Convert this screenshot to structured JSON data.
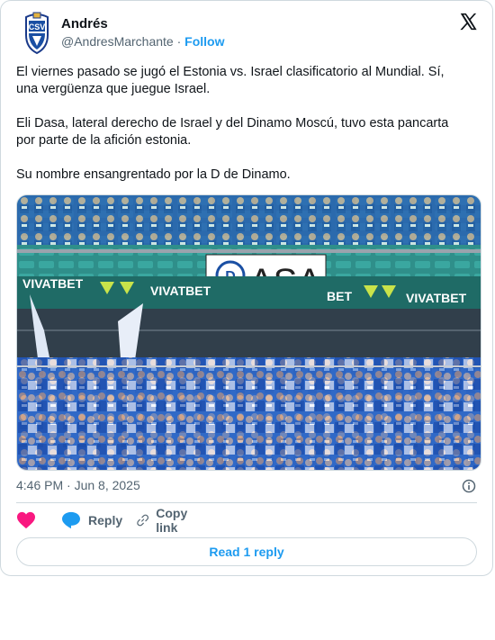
{
  "author": {
    "name": "Andrés",
    "handle": "@AndresMarchante",
    "separator": "·",
    "follow_label": "Follow",
    "avatar_icon": "club-crest-icon"
  },
  "tweet": {
    "paragraphs": [
      "El viernes pasado se jugó el Estonia vs. Israel clasificatorio al Mundial. Sí, una vergüenza que juegue Israel.",
      "Eli Dasa, lateral derecho de Israel y del Dinamo Moscú, tuvo esta pancarta por parte de la afición estonia.",
      "Su nombre ensangrentado por la D de Dinamo."
    ],
    "photo": {
      "banner_text": "ASA",
      "sponsor_text": "VIVATBET"
    },
    "timestamp": "4:46 PM · Jun 8, 2025"
  },
  "actions": {
    "like_icon": "heart-icon",
    "reply_label": "Reply",
    "copy_link_label": "Copy link"
  },
  "read_replies_label": "Read 1 reply",
  "colors": {
    "accent": "#1d9bf0",
    "like": "#f91880",
    "border": "#cfd9de",
    "muted": "#536471"
  }
}
